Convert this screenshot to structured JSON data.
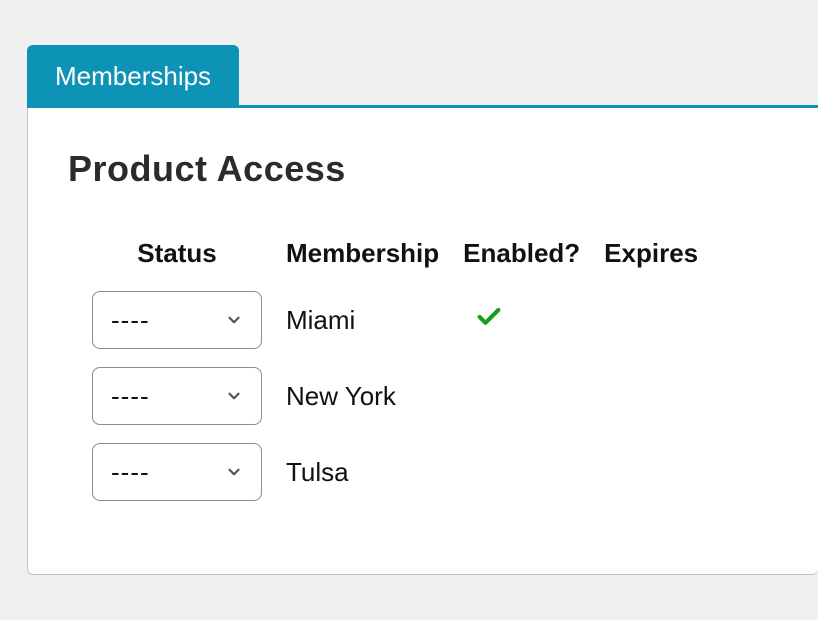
{
  "tab": {
    "label": "Memberships"
  },
  "panel": {
    "title": "Product Access",
    "columns": {
      "status": "Status",
      "membership": "Membership",
      "enabled": "Enabled?",
      "expires": "Expires"
    },
    "select_placeholder": "----",
    "rows": [
      {
        "status": "----",
        "membership": "Miami",
        "enabled": true,
        "expires": ""
      },
      {
        "status": "----",
        "membership": "New York",
        "enabled": false,
        "expires": ""
      },
      {
        "status": "----",
        "membership": "Tulsa",
        "enabled": false,
        "expires": ""
      }
    ]
  }
}
